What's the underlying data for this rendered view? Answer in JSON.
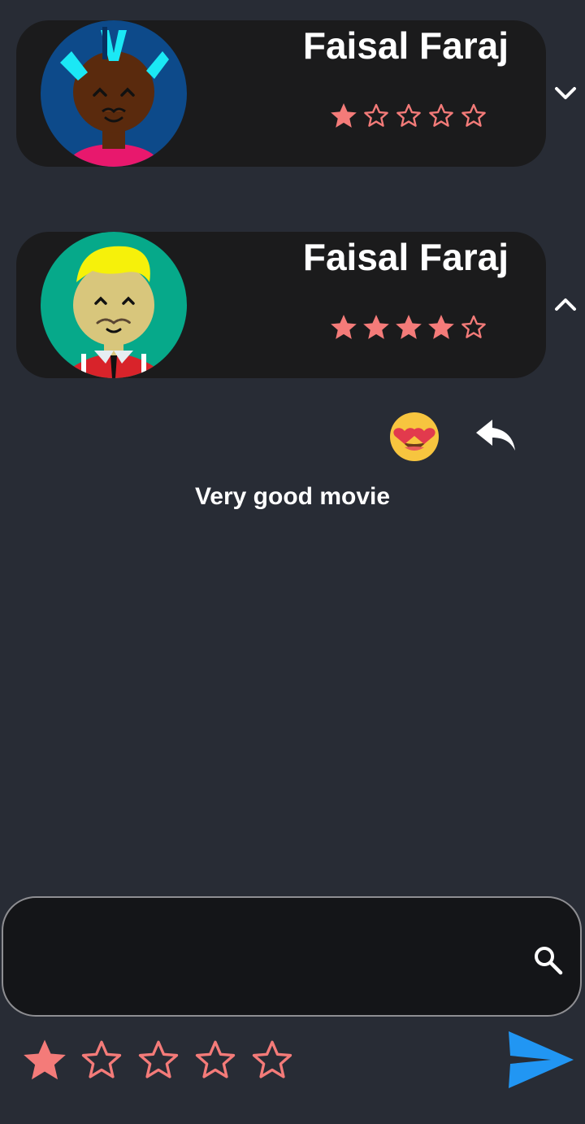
{
  "reviews": [
    {
      "name": "Faisal Faraj",
      "rating": 1,
      "max_rating": 5,
      "avatar": "avatar-blue-dark-skin-cyan-hair-icon",
      "expanded": false,
      "toggle_icon": "chevron-down-icon"
    },
    {
      "name": "Faisal Faraj",
      "rating": 4,
      "max_rating": 5,
      "avatar": "avatar-teal-blonde-hair-icon",
      "expanded": true,
      "toggle_icon": "chevron-up-icon"
    }
  ],
  "expanded_review": {
    "reaction_icon": "heart-eyes-emoji-icon",
    "reply_icon": "reply-arrow-icon",
    "comment": "Very good movie"
  },
  "composer": {
    "input_value": "",
    "input_placeholder": "",
    "search_icon": "search-icon",
    "rating": 1,
    "max_rating": 5,
    "send_icon": "send-icon"
  },
  "colors": {
    "background": "#282c35",
    "card": "#1b1b1c",
    "star": "#f47b79",
    "send": "#2196f3",
    "input_bg": "#141518",
    "input_border": "#8e8e92"
  }
}
